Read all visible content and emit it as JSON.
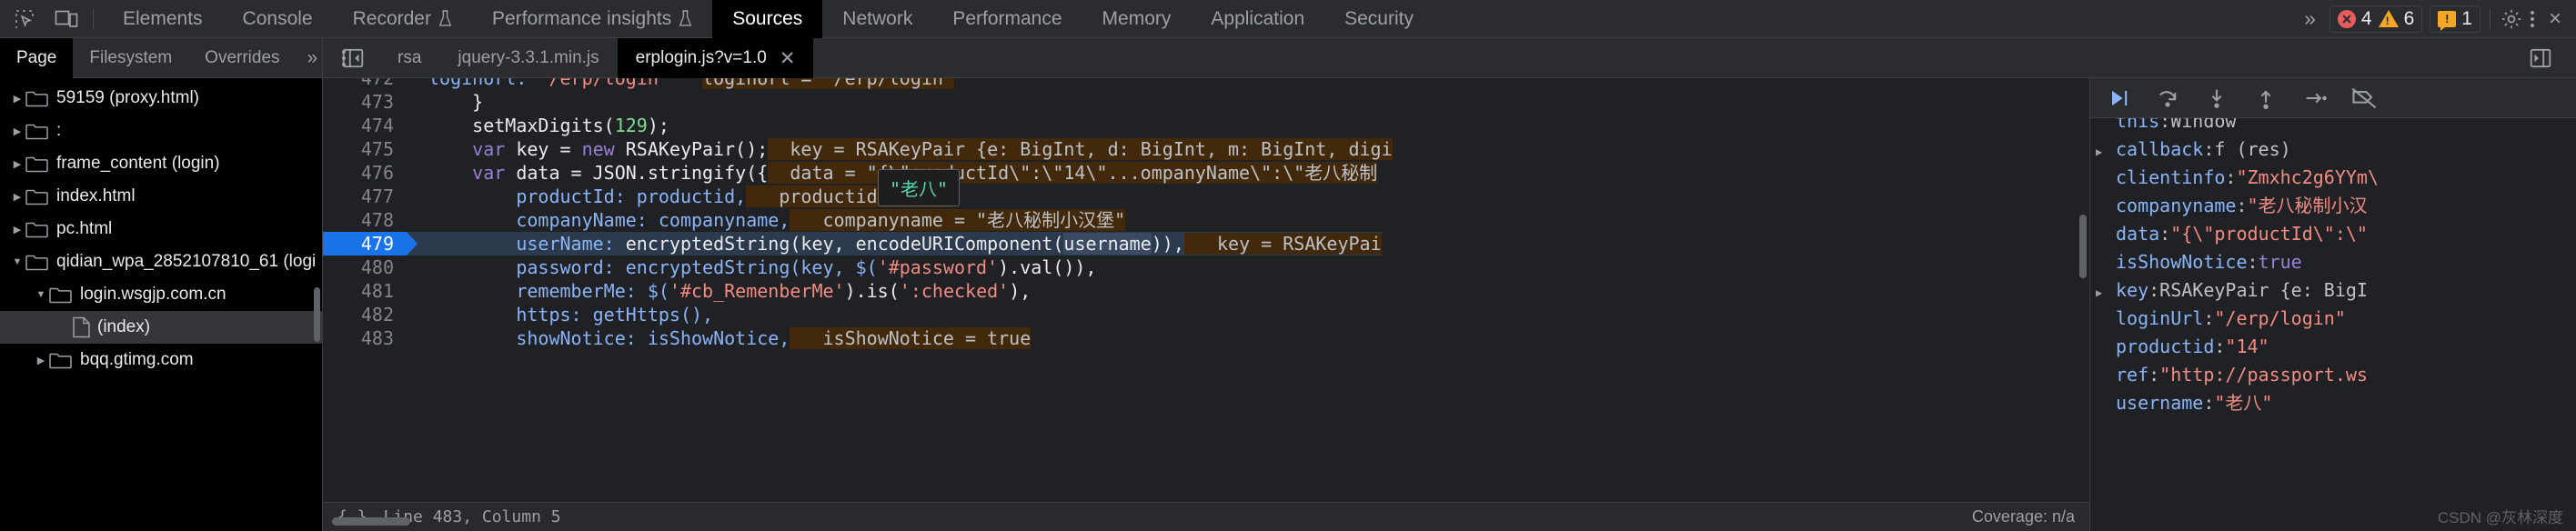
{
  "toolbar": {
    "icons": [
      {
        "name": "inspect-element-icon",
        "label": "inspect"
      },
      {
        "name": "device-toolbar-icon",
        "label": "device"
      }
    ],
    "tabs": [
      {
        "label": "Elements",
        "active": false,
        "experiment": false
      },
      {
        "label": "Console",
        "active": false,
        "experiment": false
      },
      {
        "label": "Recorder",
        "active": false,
        "experiment": true
      },
      {
        "label": "Performance insights",
        "active": false,
        "experiment": true
      },
      {
        "label": "Sources",
        "active": true,
        "experiment": false
      },
      {
        "label": "Network",
        "active": false,
        "experiment": false
      },
      {
        "label": "Performance",
        "active": false,
        "experiment": false
      },
      {
        "label": "Memory",
        "active": false,
        "experiment": false
      },
      {
        "label": "Application",
        "active": false,
        "experiment": false
      },
      {
        "label": "Security",
        "active": false,
        "experiment": false
      }
    ],
    "overflow_label": "»",
    "badges": {
      "errors": "4",
      "warnings": "6",
      "issues": "1"
    },
    "settings_label": "gear-icon",
    "more_label": "kebab-icon",
    "close_label": "×"
  },
  "navigator": {
    "tabs": [
      {
        "label": "Page",
        "active": true
      },
      {
        "label": "Filesystem",
        "active": false
      },
      {
        "label": "Overrides",
        "active": false
      }
    ],
    "overflow_label": "»",
    "more_label": "kebab-icon",
    "tree": [
      {
        "indent": 0,
        "twisty": "▶",
        "icon": "folder",
        "label": "59159 (proxy.html)",
        "selected": false
      },
      {
        "indent": 0,
        "twisty": "▶",
        "icon": "folder",
        "label": ":",
        "selected": false
      },
      {
        "indent": 0,
        "twisty": "▶",
        "icon": "folder",
        "label": "frame_content (login)",
        "selected": false
      },
      {
        "indent": 0,
        "twisty": "▶",
        "icon": "folder",
        "label": "index.html",
        "selected": false
      },
      {
        "indent": 0,
        "twisty": "▶",
        "icon": "folder",
        "label": "pc.html",
        "selected": false
      },
      {
        "indent": 0,
        "twisty": "▼",
        "icon": "folder",
        "label": "qidian_wpa_2852107810_61 (logi",
        "selected": false
      },
      {
        "indent": 1,
        "twisty": "▼",
        "icon": "folder",
        "label": "login.wsgjp.com.cn",
        "selected": false
      },
      {
        "indent": 2,
        "twisty": "",
        "icon": "doc",
        "label": "(index)",
        "selected": true
      },
      {
        "indent": 1,
        "twisty": "▶",
        "icon": "folder",
        "label": "bqq.gtimg.com",
        "selected": false
      }
    ]
  },
  "file_tabs": {
    "panel_icon": "collapse-sidebar-icon",
    "tabs": [
      {
        "label": "rsa",
        "active": false,
        "closable": false
      },
      {
        "label": "jquery-3.3.1.min.js",
        "active": false,
        "closable": false
      },
      {
        "label": "erplogin.js?v=1.0",
        "active": true,
        "closable": true
      }
    ],
    "close_label": "✕",
    "right_panel_icon": "show-navigator-icon"
  },
  "code": {
    "lines": [
      {
        "number": "472",
        "clipped": true,
        "tokens": [
          {
            "t": "loginUrl: ",
            "c": "prop"
          },
          {
            "t": "\"/erp/login\"",
            "c": "str"
          },
          {
            "t": "   ",
            "c": "plain"
          },
          {
            "t": "loginUrl = \"/erp/login\"",
            "c": "eval"
          }
        ]
      },
      {
        "number": "473",
        "tokens": [
          {
            "t": "    }",
            "c": "plain"
          }
        ]
      },
      {
        "number": "474",
        "tokens": [
          {
            "t": "    setMaxDigits(",
            "c": "plain"
          },
          {
            "t": "129",
            "c": "num"
          },
          {
            "t": ");",
            "c": "plain"
          }
        ]
      },
      {
        "number": "475",
        "tokens": [
          {
            "t": "    ",
            "c": "plain"
          },
          {
            "t": "var",
            "c": "kw"
          },
          {
            "t": " key = ",
            "c": "plain"
          },
          {
            "t": "new",
            "c": "kw"
          },
          {
            "t": " RSAKeyPair();",
            "c": "plain"
          },
          {
            "t": "  key = RSAKeyPair {e: BigInt, d: BigInt, m: BigInt, digi",
            "c": "eval"
          }
        ]
      },
      {
        "number": "476",
        "tokens": [
          {
            "t": "    ",
            "c": "plain"
          },
          {
            "t": "var",
            "c": "kw"
          },
          {
            "t": " data = JSON.stringify({",
            "c": "plain"
          },
          {
            "t": "  data = \"{\\\"productId\\\":\\\"14\\\"...ompanyName\\\":\\\"老八秘制",
            "c": "eval"
          }
        ]
      },
      {
        "number": "477",
        "tokens": [
          {
            "t": "        productId: productid,",
            "c": "prop"
          },
          {
            "t": "   productid = \"14\"",
            "c": "eval"
          }
        ]
      },
      {
        "number": "478",
        "tokens": [
          {
            "t": "        companyName: companyname,",
            "c": "prop"
          },
          {
            "t": "   companyname = \"老八秘制小汉堡\"",
            "c": "eval"
          }
        ]
      },
      {
        "number": "479",
        "highlight": true,
        "tokens": [
          {
            "t": "        userName: ",
            "c": "prop"
          },
          {
            "t": "encryptedString",
            "c": "fn"
          },
          {
            "t": "(key, ",
            "c": "plain"
          },
          {
            "t": "encodeURIComponent",
            "c": "fn"
          },
          {
            "t": "(",
            "c": "plain"
          },
          {
            "t": "username",
            "c": "sel"
          },
          {
            "t": ")),",
            "c": "plain"
          },
          {
            "t": "   key = RSAKeyPai",
            "c": "eval"
          }
        ]
      },
      {
        "number": "480",
        "tokens": [
          {
            "t": "        password: encryptedString(key, $(",
            "c": "prop"
          },
          {
            "t": "'#password'",
            "c": "str"
          },
          {
            "t": ").val()),",
            "c": "plain"
          }
        ]
      },
      {
        "number": "481",
        "tokens": [
          {
            "t": "        rememberMe: $(",
            "c": "prop"
          },
          {
            "t": "'#cb_RemenberMe'",
            "c": "str"
          },
          {
            "t": ").is(",
            "c": "plain"
          },
          {
            "t": "':checked'",
            "c": "str"
          },
          {
            "t": "),",
            "c": "plain"
          }
        ]
      },
      {
        "number": "482",
        "tokens": [
          {
            "t": "        https: getHttps(),",
            "c": "prop"
          }
        ]
      },
      {
        "number": "483",
        "tokens": [
          {
            "t": "        showNotice: isShowNotice,",
            "c": "prop"
          },
          {
            "t": "   isShowNotice = true",
            "c": "eval"
          }
        ]
      }
    ],
    "tooltip": "\"老八\""
  },
  "status": {
    "position": "Line 483, Column 5",
    "coverage": "Coverage: n/a"
  },
  "debugger": {
    "buttons": [
      {
        "name": "resume-script-button",
        "glyph": "resume"
      },
      {
        "name": "step-over-button",
        "glyph": "step-over"
      },
      {
        "name": "step-into-button",
        "glyph": "step-into"
      },
      {
        "name": "step-out-button",
        "glyph": "step-out"
      },
      {
        "name": "step-button",
        "glyph": "step"
      },
      {
        "name": "deactivate-breakpoints-button",
        "glyph": "no-breakpoints"
      }
    ],
    "scope": [
      {
        "arrow": "",
        "key": "this",
        "sep": ": ",
        "value": "Window",
        "vclass": "obj",
        "clipped": true
      },
      {
        "arrow": "▶",
        "key": "callback",
        "sep": ": ",
        "value": "f (res)",
        "vclass": "obj"
      },
      {
        "arrow": "",
        "key": "clientinfo",
        "sep": ": ",
        "value": "\"Zmxhc2g6YYm\\",
        "vclass": "str"
      },
      {
        "arrow": "",
        "key": "companyname",
        "sep": ": ",
        "value": "\"老八秘制小汉",
        "vclass": "str"
      },
      {
        "arrow": "",
        "key": "data",
        "sep": ": ",
        "value": "\"{\\\"productId\\\":\\\"",
        "vclass": "str"
      },
      {
        "arrow": "",
        "key": "isShowNotice",
        "sep": ": ",
        "value": "true",
        "vclass": "bool"
      },
      {
        "arrow": "▶",
        "key": "key",
        "sep": ": ",
        "value": "RSAKeyPair {e: BigI",
        "vclass": "obj"
      },
      {
        "arrow": "",
        "key": "loginUrl",
        "sep": ": ",
        "value": "\"/erp/login\"",
        "vclass": "str"
      },
      {
        "arrow": "",
        "key": "productid",
        "sep": ": ",
        "value": "\"14\"",
        "vclass": "str"
      },
      {
        "arrow": "",
        "key": "ref",
        "sep": ": ",
        "value": "\"http://passport.ws",
        "vclass": "str"
      },
      {
        "arrow": "",
        "key": "username",
        "sep": ": ",
        "value": "\"老八\"",
        "vclass": "str"
      }
    ]
  },
  "watermark": "CSDN @灰林深度"
}
